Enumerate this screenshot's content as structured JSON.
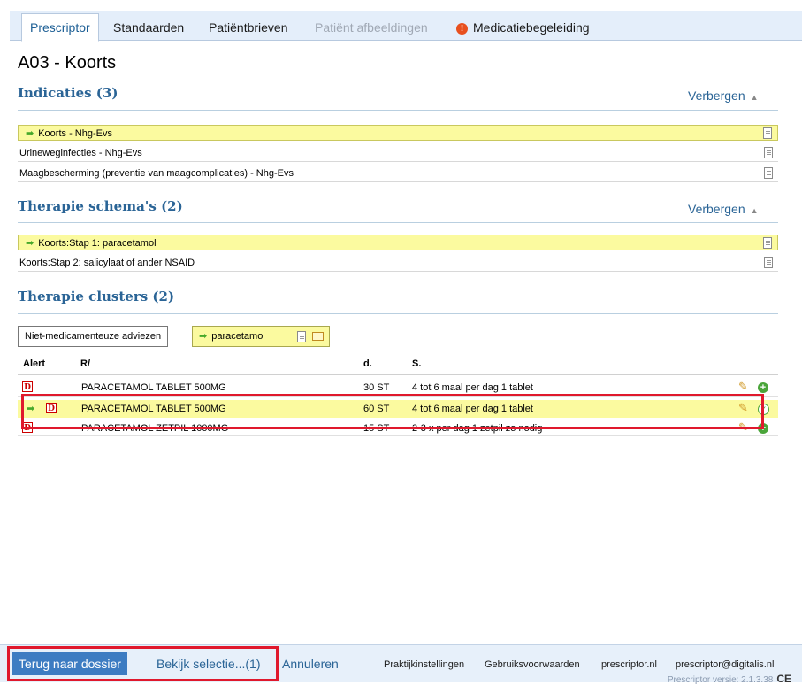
{
  "tabs": [
    {
      "label": "Prescriptor"
    },
    {
      "label": "Standaarden"
    },
    {
      "label": "Patiëntbrieven"
    },
    {
      "label": "Patiënt afbeeldingen"
    },
    {
      "label": "Medicatiebegeleiding"
    }
  ],
  "page_title": "A03 - Koorts",
  "indicaties": {
    "title": "Indicaties (3)",
    "hide_label": "Verbergen",
    "items": [
      {
        "label": "Koorts - Nhg-Evs",
        "selected": true
      },
      {
        "label": "Urineweginfecties - Nhg-Evs",
        "selected": false
      },
      {
        "label": "Maagbescherming (preventie van maagcomplicaties) - Nhg-Evs",
        "selected": false
      }
    ]
  },
  "schemas": {
    "title": "Therapie schema's (2)",
    "hide_label": "Verbergen",
    "items": [
      {
        "label": "Koorts:Stap 1: paracetamol",
        "selected": true
      },
      {
        "label": "Koorts:Stap 2: salicylaat of ander NSAID",
        "selected": false
      }
    ]
  },
  "clusters": {
    "title": "Therapie clusters (2)",
    "buttons": [
      {
        "label": "Niet-medicamenteuze adviezen"
      },
      {
        "label": "paracetamol"
      }
    ]
  },
  "table": {
    "headers": {
      "alert": "Alert",
      "rx": "R/",
      "d": "d.",
      "s": "S."
    },
    "rows": [
      {
        "badge": "D",
        "name": "PARACETAMOL TABLET 500MG",
        "d": "30 ST",
        "s": "4 tot 6 maal per dag 1 tablet",
        "selected": false
      },
      {
        "badge": "D",
        "name": "PARACETAMOL TABLET 500MG",
        "d": "60 ST",
        "s": "4 tot 6 maal per dag 1 tablet",
        "selected": true
      },
      {
        "badge": "D",
        "name": "PARACETAMOL ZETPIL 1000MG",
        "d": "15 ST",
        "s": "2-3 x per dag 1 zetpil zo nodig",
        "selected": false
      }
    ]
  },
  "footer": {
    "back": "Terug naar dossier",
    "view": "Bekijk selectie...(1)",
    "cancel": "Annuleren",
    "links": [
      "Praktijkinstellingen",
      "Gebruiksvoorwaarden",
      "prescriptor.nl",
      "prescriptor@digitalis.nl"
    ],
    "version": "Prescriptor versie: 2.1.3.38",
    "ce": "CE"
  },
  "colors": {
    "accent": "#2a6496",
    "highlight": "#fbfa9f",
    "alert": "#e0192d",
    "primary_button": "#3d7cc2"
  }
}
